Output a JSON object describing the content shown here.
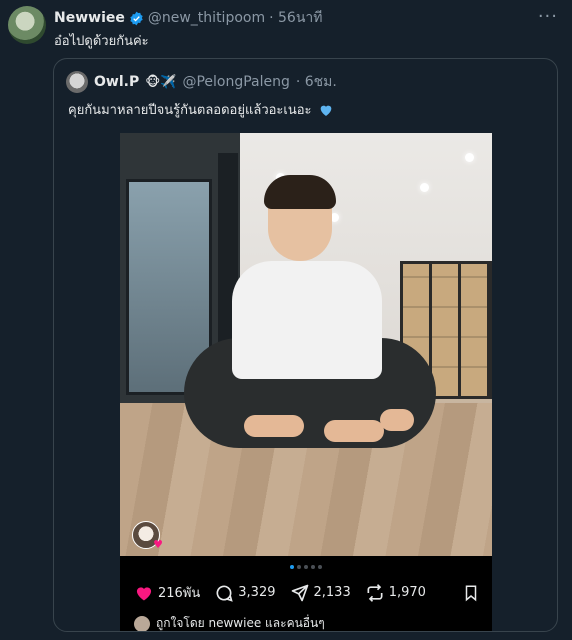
{
  "tweet": {
    "author_name": "Newwiee",
    "handle": "@new_thitipoom",
    "time": "· 56นาที",
    "text": "อ๋อไปดูด้วยกันค่ะ",
    "more_label": "···"
  },
  "quote": {
    "author_name": "Owl.P",
    "emojis": "🐵✈️",
    "handle": "@PelongPaleng",
    "time": "· 6ชม.",
    "text": "คุยกันมาหลายปีจนรู้กันตลอดอยู่แล้วอะเนอะ",
    "heart_color": "#1d9bf0"
  },
  "post_card": {
    "carousel_dots": 5,
    "active_dot": 0,
    "likes": "216พัน",
    "comments": "3,329",
    "shares": "2,133",
    "reposts": "1,970",
    "liked_by": "ถูกใจโดย newwiee และคนอื่นๆ"
  },
  "colors": {
    "background": "#15202b",
    "verified": "#1d9bf0",
    "like": "#f91880"
  }
}
